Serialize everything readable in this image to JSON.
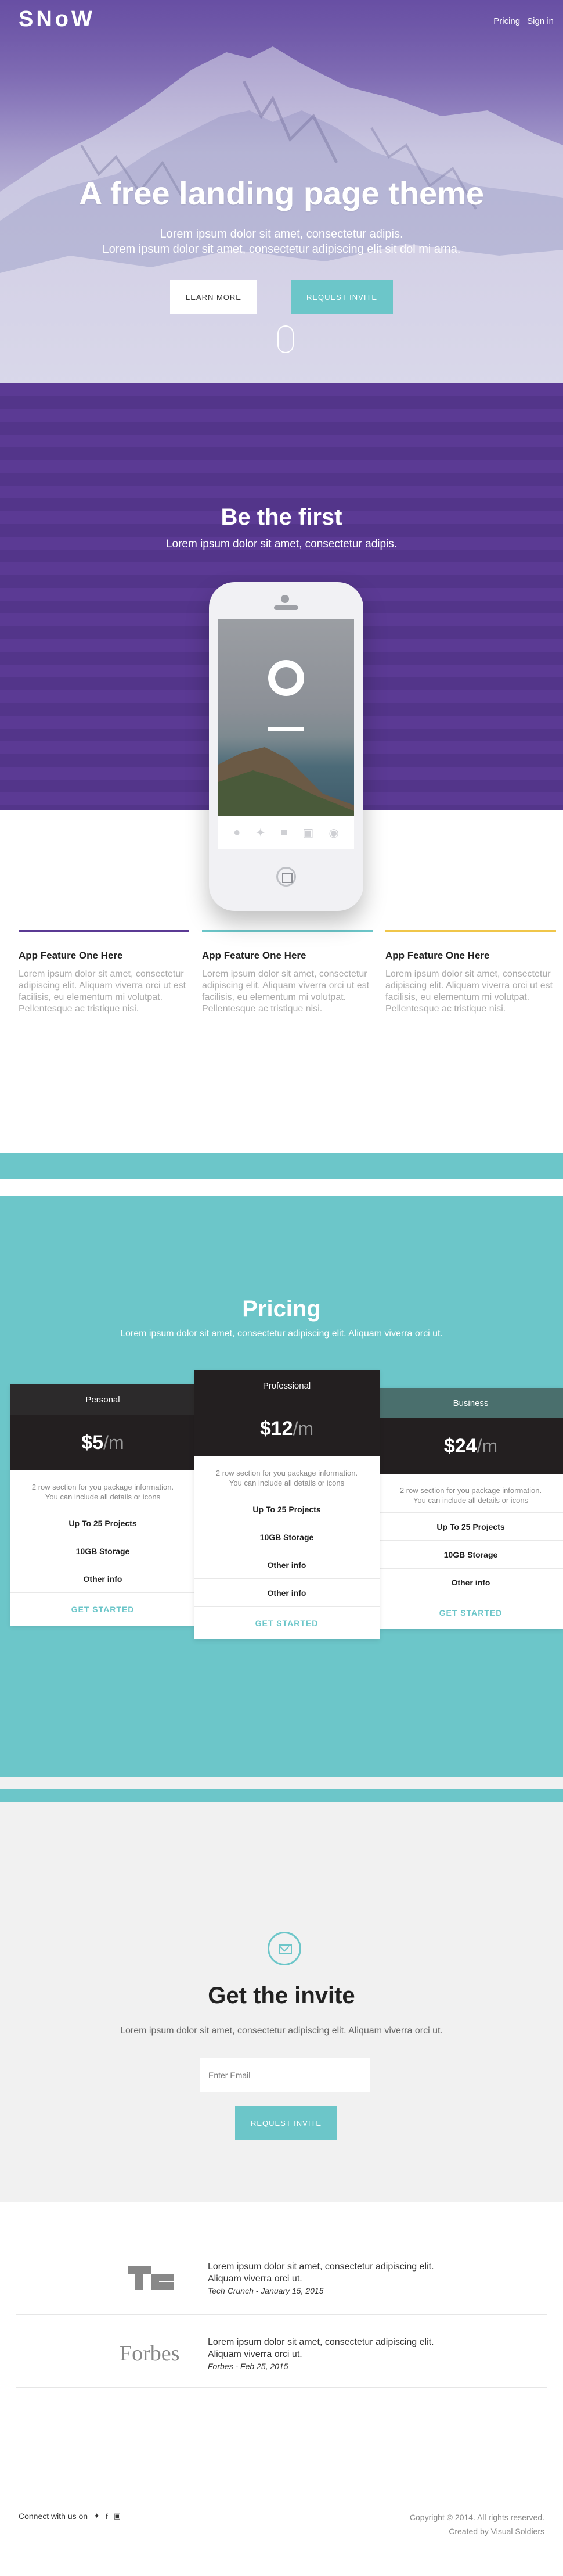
{
  "nav": {
    "logo": "SNoW",
    "links": [
      "Pricing",
      "Sign in"
    ]
  },
  "hero": {
    "title": "A free landing page theme",
    "subtitle_line1": "Lorem ipsum dolor sit amet, consectetur adipis.",
    "subtitle_line2": "Lorem ipsum dolor sit amet, consectetur adipiscing elit sit dol mi arna.",
    "btn_learn": "LEARN MORE",
    "btn_invite": "REQUEST INVITE"
  },
  "first": {
    "title": "Be the first",
    "subtitle": "Lorem ipsum dolor sit amet, consectetur adipis."
  },
  "features": [
    {
      "title": "App Feature One Here",
      "text": "Lorem ipsum dolor sit amet, consectetur adipiscing elit. Aliquam viverra orci ut est facilisis, eu elementum mi volutpat. Pellentesque ac tristique nisi.",
      "color": "#5b3a94"
    },
    {
      "title": "App Feature One Here",
      "text": "Lorem ipsum dolor sit amet, consectetur adipiscing elit. Aliquam viverra orci ut est facilisis, eu elementum mi volutpat. Pellentesque ac tristique nisi.",
      "color": "#6cc6c9"
    },
    {
      "title": "App Feature One Here",
      "text": "Lorem ipsum dolor sit amet, consectetur adipiscing elit. Aliquam viverra orci ut est facilisis, eu elementum mi volutpat. Pellentesque ac tristique nisi.",
      "color": "#f0c64a"
    }
  ],
  "pricing": {
    "title": "Pricing",
    "subtitle": "Lorem ipsum dolor sit amet, consectetur adipiscing elit. Aliquam viverra orci ut.",
    "plans": [
      {
        "name": "Personal",
        "price": "$5",
        "per": "/m",
        "desc_line1": "2 row section for you package information.",
        "desc_line2": "You can include all details or icons",
        "features": [
          "Up To 25 Projects",
          "10GB Storage",
          "Other info"
        ],
        "cta": "GET STARTED"
      },
      {
        "name": "Professional",
        "price": "$12",
        "per": "/m",
        "desc_line1": "2 row section for you package information.",
        "desc_line2": "You can include all details or icons",
        "features": [
          "Up To 25 Projects",
          "10GB Storage",
          "Other info",
          "Other info"
        ],
        "cta": "GET STARTED"
      },
      {
        "name": "Business",
        "price": "$24",
        "per": "/m",
        "desc_line1": "2 row section for you package information.",
        "desc_line2": "You can include all details or icons",
        "features": [
          "Up To 25 Projects",
          "10GB Storage",
          "Other info"
        ],
        "cta": "GET STARTED"
      }
    ]
  },
  "invite": {
    "title": "Get the invite",
    "subtitle": "Lorem ipsum dolor sit amet, consectetur adipiscing elit. Aliquam viverra orci ut.",
    "placeholder": "Enter Email",
    "button": "REQUEST INVITE"
  },
  "testimonials": [
    {
      "logo": "TC",
      "line1": "Lorem ipsum dolor sit amet, consectetur adipiscing elit.",
      "line2": "Aliquam viverra orci ut.",
      "source": "Tech Crunch - January 15, 2015"
    },
    {
      "logo": "Forbes",
      "line1": "Lorem ipsum dolor sit amet, consectetur adipiscing elit.",
      "line2": "Aliquam viverra orci ut.",
      "source": "Forbes - Feb 25, 2015"
    }
  ],
  "footer": {
    "connect": "Connect with us on",
    "copyright": "Copyright © 2014. All rights reserved.",
    "credit": "Created by Visual Soldiers"
  },
  "colors": {
    "purple": "#5b3a94",
    "teal": "#6cc6c9",
    "yellow": "#f0c64a",
    "dark": "#2c2a2b"
  }
}
